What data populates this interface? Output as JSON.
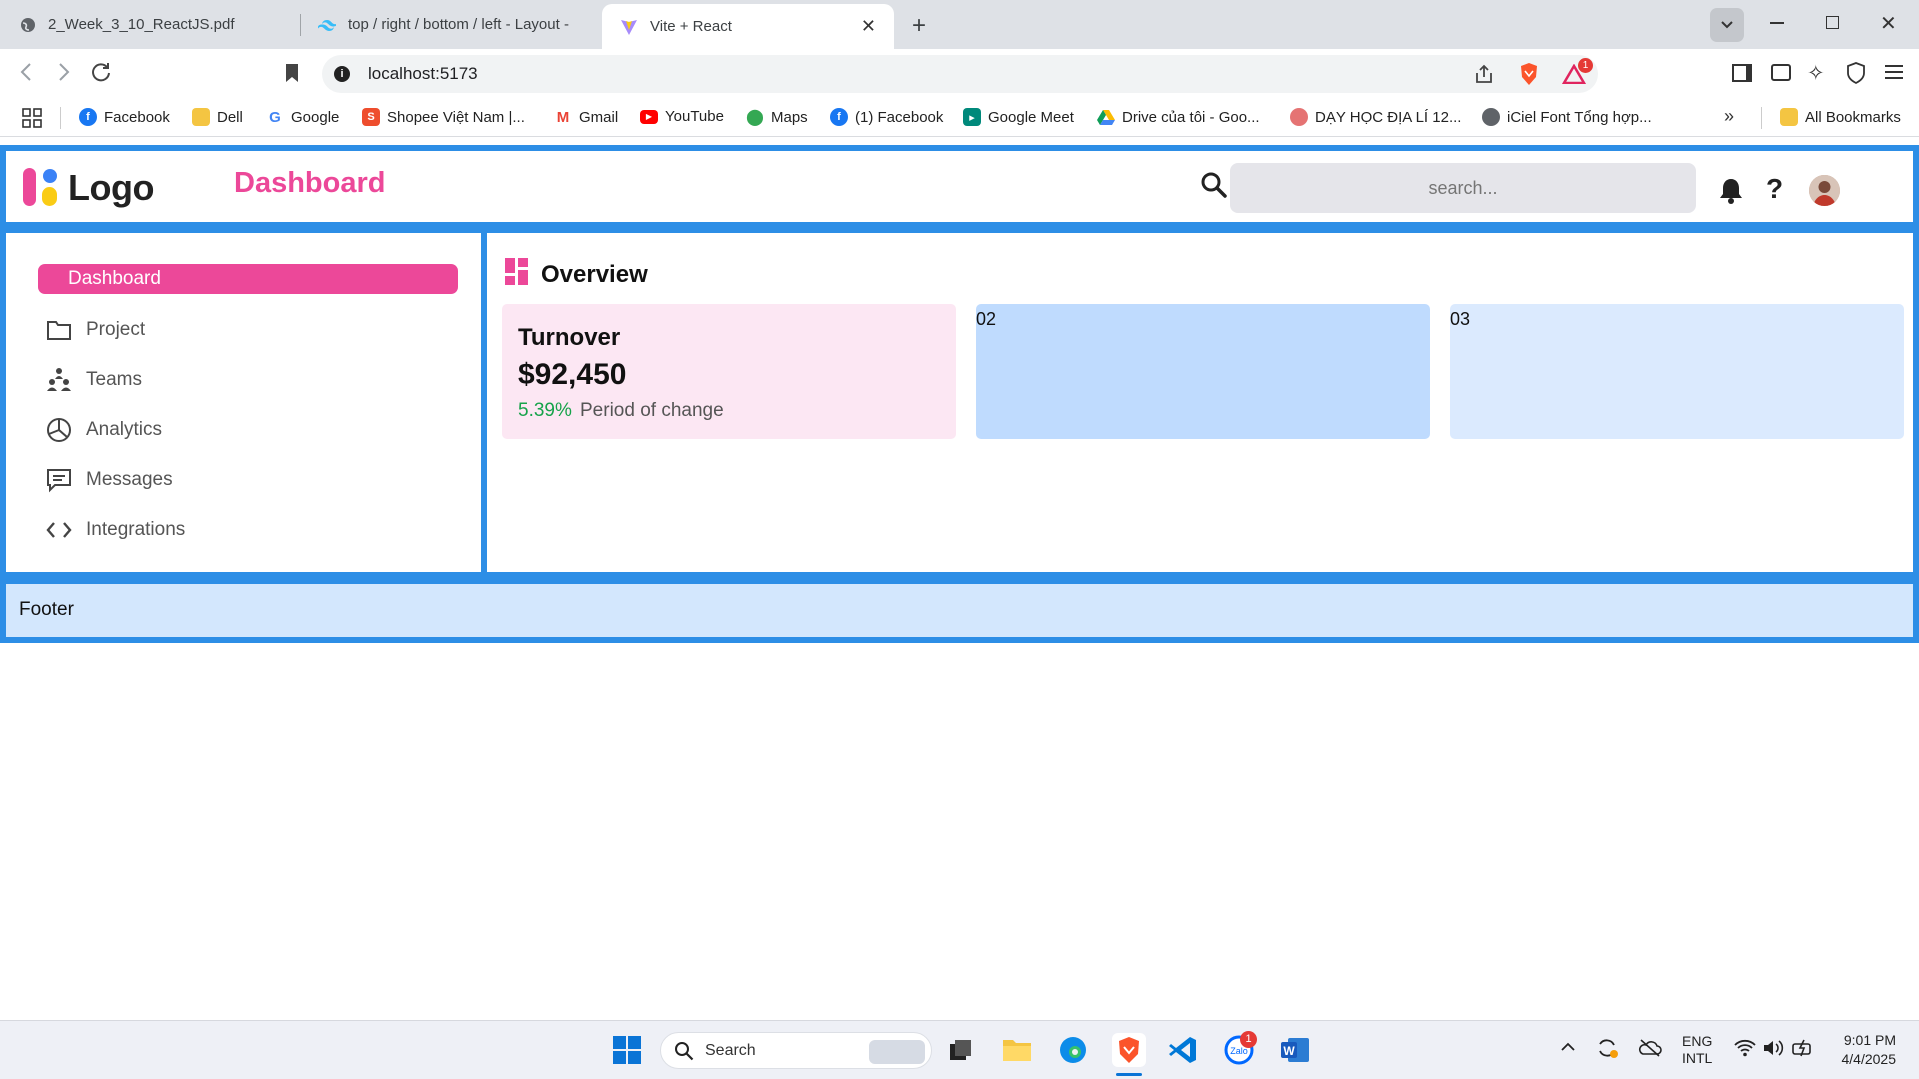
{
  "browser": {
    "tabs": [
      {
        "title": "2_Week_3_10_ReactJS.pdf",
        "active": false
      },
      {
        "title": "top / right / bottom / left - Layout -",
        "active": false
      },
      {
        "title": "Vite + React",
        "active": true
      }
    ],
    "url": "localhost:5173",
    "extension_badge": "1",
    "bookmarks": [
      {
        "label": "Facebook",
        "icon": "facebook-icon"
      },
      {
        "label": "Dell",
        "icon": "folder-icon"
      },
      {
        "label": "Google",
        "icon": "google-icon"
      },
      {
        "label": "Shopee Việt Nam |...",
        "icon": "shopee-icon"
      },
      {
        "label": "Gmail",
        "icon": "gmail-icon"
      },
      {
        "label": "YouTube",
        "icon": "youtube-icon"
      },
      {
        "label": "Maps",
        "icon": "maps-icon"
      },
      {
        "label": "(1) Facebook",
        "icon": "facebook-icon"
      },
      {
        "label": "Google Meet",
        "icon": "meet-icon"
      },
      {
        "label": "Drive của tôi - Goo...",
        "icon": "drive-icon"
      },
      {
        "label": "DẠY HỌC ĐỊA LÍ 12...",
        "icon": "site-icon"
      },
      {
        "label": "iCiel Font Tổng hợp...",
        "icon": "globe-icon"
      }
    ],
    "all_bookmarks_label": "All Bookmarks"
  },
  "header": {
    "logo_text": "Logo",
    "title": "Dashboard",
    "search_placeholder": "search..."
  },
  "sidebar": {
    "items": [
      {
        "label": "Dashboard",
        "icon": "dashboard-icon",
        "active": true
      },
      {
        "label": "Project",
        "icon": "folder-icon",
        "active": false
      },
      {
        "label": "Teams",
        "icon": "teams-icon",
        "active": false
      },
      {
        "label": "Analytics",
        "icon": "pie-chart-icon",
        "active": false
      },
      {
        "label": "Messages",
        "icon": "message-icon",
        "active": false
      },
      {
        "label": "Integrations",
        "icon": "code-icon",
        "active": false
      }
    ]
  },
  "main": {
    "section_title": "Overview",
    "cards": [
      {
        "title": "Turnover",
        "value": "$92,450",
        "change": "5.39%",
        "change_label": "Period of change",
        "color": "#fce7f3"
      },
      {
        "title": "02",
        "color": "#bfdbfe"
      },
      {
        "title": "03",
        "color": "#dbeafe"
      }
    ]
  },
  "footer": {
    "text": "Footer"
  },
  "taskbar": {
    "search_label": "Search",
    "zalo_badge": "1",
    "lang_line1": "ENG",
    "lang_line2": "INTL",
    "time": "9:01 PM",
    "date": "4/4/2025"
  },
  "colors": {
    "accent_pink": "#ec4899",
    "border_blue": "#2d8ee6",
    "change_green": "#16a34a",
    "footer_bg": "#d3e7fd"
  }
}
